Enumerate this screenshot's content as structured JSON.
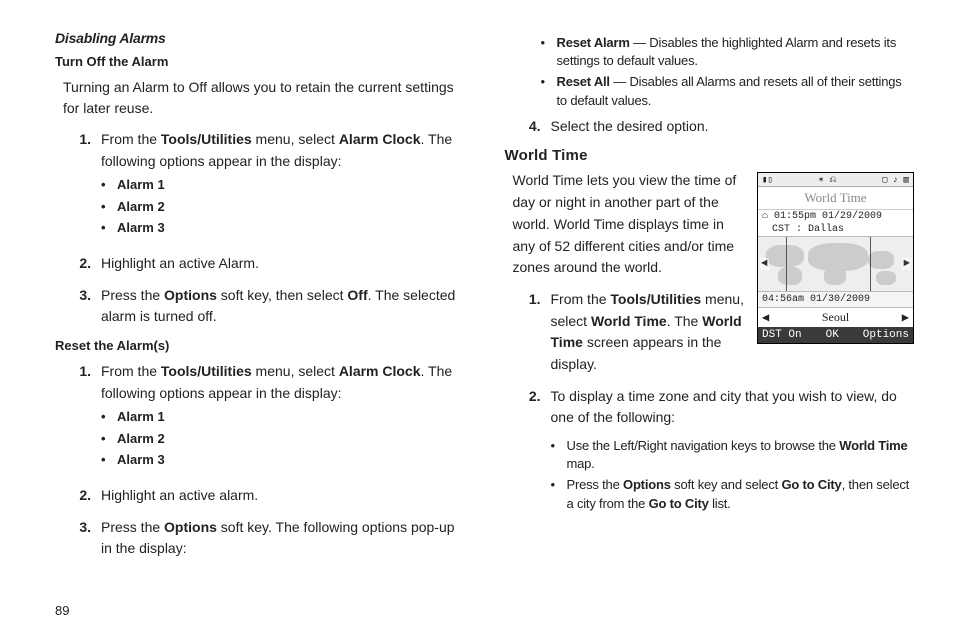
{
  "page_number": "89",
  "left": {
    "h1": "Disabling Alarms",
    "h2a": "Turn Off the Alarm",
    "p1": "Turning an Alarm to Off allows you to retain the current settings for later reuse.",
    "s1_pre": "From the ",
    "s1_b1": "Tools/Utilities",
    "s1_mid": " menu, select ",
    "s1_b2": "Alarm Clock",
    "s1_post": ". The following options appear in the display:",
    "alarms": [
      "Alarm 1",
      "Alarm 2",
      "Alarm 3"
    ],
    "s2": "Highlight an active Alarm.",
    "s3_pre": "Press the ",
    "s3_b1": "Options",
    "s3_mid": " soft key, then select ",
    "s3_b2": "Off",
    "s3_post": ". The selected alarm is turned off.",
    "h2b": "Reset the Alarm(s)",
    "r1_pre": "From the ",
    "r1_b1": "Tools/Utilities",
    "r1_mid": " menu, select ",
    "r1_b2": "Alarm Clock",
    "r1_post": ". The following options appear in the display:",
    "r2": "Highlight an active alarm.",
    "r3_pre": "Press the ",
    "r3_b1": "Options",
    "r3_post": " soft key. The following options pop-up in the display:"
  },
  "right": {
    "b1a": "Reset Alarm",
    "b1b": " — Disables the highlighted Alarm and resets its settings to default values.",
    "b2a": "Reset All",
    "b2b": " — Disables all Alarms and resets all of their settings to default values.",
    "s4": "Select the desired option.",
    "h_section": "World Time",
    "intro": "World Time lets you view the time of day or night in another part of the world. World Time displays time in any of 52 different cities and/or time zones around the world.",
    "w1_pre": "From the ",
    "w1_b1": "Tools/Utilities",
    "w1_mid1": " menu, select ",
    "w1_b2": "World Time",
    "w1_mid2": ". The ",
    "w1_b3": "World Time",
    "w1_post": " screen appears in the display.",
    "w2": "To display a time zone and city that you wish to view, do one of the following:",
    "wb1_pre": "Use the Left/Right navigation keys to browse the ",
    "wb1_b": "World Time",
    "wb1_post": " map.",
    "wb2_pre": "Press the ",
    "wb2_b1": "Options",
    "wb2_mid": " soft key and select ",
    "wb2_b2": "Go to City",
    "wb2_mid2": ", then select a city from the ",
    "wb2_b3": "Go to City",
    "wb2_post": " list."
  },
  "device": {
    "title": "World Time",
    "home_time": "01:55pm 01/29/2009",
    "home_city": "CST : Dallas",
    "away_time": "04:56am 01/30/2009",
    "city": "Seoul",
    "soft_left": "DST On",
    "soft_mid": "OK",
    "soft_right": "Options",
    "left_arrow": "◄",
    "right_arrow": "►",
    "tri_left": "◀",
    "tri_right": "▶",
    "home_icon": "⌂"
  }
}
